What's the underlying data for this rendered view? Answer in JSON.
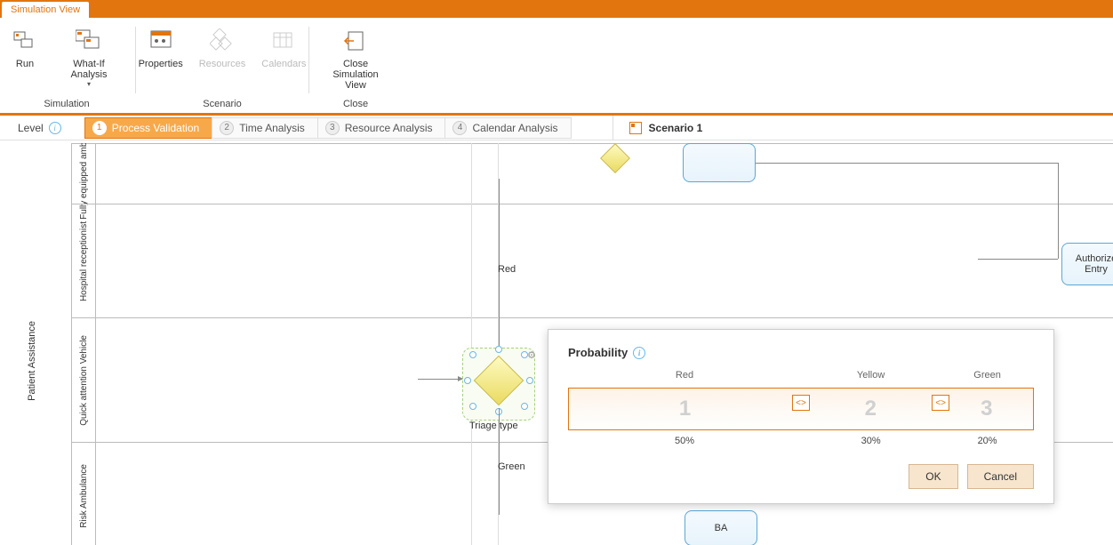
{
  "top_tab": "Simulation View",
  "ribbon": {
    "simulation": {
      "title": "Simulation",
      "run": "Run",
      "whatif": "What-If Analysis"
    },
    "scenario": {
      "title": "Scenario",
      "properties": "Properties",
      "resources": "Resources",
      "calendars": "Calendars"
    },
    "close": {
      "title": "Close",
      "close_sim": "Close\nSimulation View"
    }
  },
  "level": {
    "label": "Level",
    "steps": [
      {
        "num": "1",
        "label": "Process Validation",
        "active": true
      },
      {
        "num": "2",
        "label": "Time Analysis",
        "active": false
      },
      {
        "num": "3",
        "label": "Resource Analysis",
        "active": false
      },
      {
        "num": "4",
        "label": "Calendar Analysis",
        "active": false
      }
    ]
  },
  "scenario_current": "Scenario 1",
  "pool": "Patient Assistance",
  "lanes": {
    "l1": "Fully equipped ambu…",
    "l2": "Hospital receptionist",
    "l3": "Quick attention Vehicle",
    "l4": "Risk Ambulance"
  },
  "gateway": "Triage type",
  "flows": {
    "red": "Red",
    "green": "Green"
  },
  "tasks": {
    "ba": "BA",
    "authorize": "Authorize Entry"
  },
  "popup": {
    "title": "Probability",
    "headers": {
      "red": "Red",
      "yellow": "Yellow",
      "green": "Green"
    },
    "values": {
      "red": "1",
      "yellow": "2",
      "green": "3"
    },
    "percents": {
      "red": "50%",
      "yellow": "30%",
      "green": "20%"
    },
    "ok": "OK",
    "cancel": "Cancel"
  }
}
